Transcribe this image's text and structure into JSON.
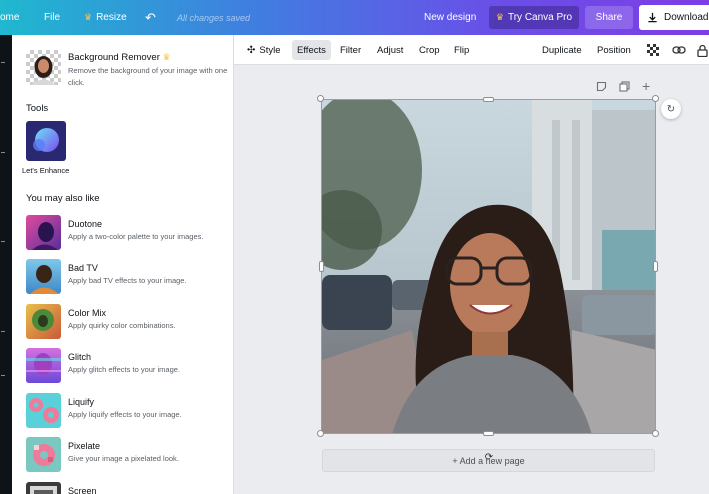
{
  "topbar": {
    "home": "ome",
    "file": "File",
    "resize": "Resize",
    "undo_icon": "undo-icon",
    "save_status": "All changes saved",
    "new_design": "New design",
    "try_pro": "Try Canva Pro",
    "share": "Share",
    "download": "Download"
  },
  "panel": {
    "bg_remover": {
      "title": "Background Remover",
      "desc": "Remove the background of your image with one click."
    },
    "tools_title": "Tools",
    "enhance_label": "Let's Enhance",
    "also_like_title": "You may also like",
    "effects": [
      {
        "name": "Duotone",
        "desc": "Apply a two-color palette to your images."
      },
      {
        "name": "Bad TV",
        "desc": "Apply bad TV effects to your image."
      },
      {
        "name": "Color Mix",
        "desc": "Apply quirky color combinations."
      },
      {
        "name": "Glitch",
        "desc": "Apply glitch effects to your image."
      },
      {
        "name": "Liquify",
        "desc": "Apply liquify effects to your image."
      },
      {
        "name": "Pixelate",
        "desc": "Give your image a pixelated look."
      },
      {
        "name": "Screen",
        "desc": ""
      }
    ]
  },
  "toolbar": {
    "style": "Style",
    "effects": "Effects",
    "filter": "Filter",
    "adjust": "Adjust",
    "crop": "Crop",
    "flip": "Flip",
    "duplicate": "Duplicate",
    "position": "Position"
  },
  "canvas": {
    "add_page": "+ Add a new page"
  },
  "colors": {
    "selection": "#2ecbd4",
    "brand_gradient_start": "#1fb8cf",
    "brand_gradient_end": "#7d3de6"
  }
}
